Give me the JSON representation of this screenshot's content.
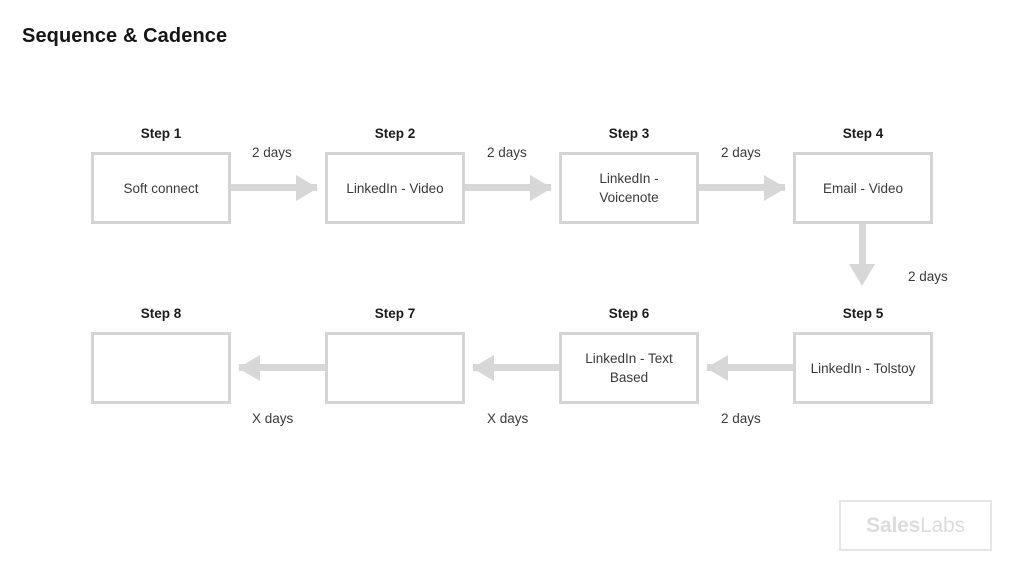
{
  "page": {
    "title": "Sequence & Cadence",
    "background_color": "#ffffff",
    "accent_color": "#d4d4d4",
    "text_color": "#3a3a3a"
  },
  "steps": [
    {
      "label": "Step 1",
      "content": "Soft connect"
    },
    {
      "label": "Step 2",
      "content": "LinkedIn - Video"
    },
    {
      "label": "Step 3",
      "content": "LinkedIn -\nVoicenote"
    },
    {
      "label": "Step 4",
      "content": "Email - Video"
    },
    {
      "label": "Step 5",
      "content": "LinkedIn - Tolstoy"
    },
    {
      "label": "Step 6",
      "content": "LinkedIn - Text\nBased"
    },
    {
      "label": "Step 7",
      "content": ""
    },
    {
      "label": "Step 8",
      "content": ""
    }
  ],
  "connectors": [
    {
      "from": "Step 1",
      "to": "Step 2",
      "delay": "2 days",
      "direction": "right"
    },
    {
      "from": "Step 2",
      "to": "Step 3",
      "delay": "2 days",
      "direction": "right"
    },
    {
      "from": "Step 3",
      "to": "Step 4",
      "delay": "2 days",
      "direction": "right"
    },
    {
      "from": "Step 4",
      "to": "Step 5",
      "delay": "2 days",
      "direction": "down"
    },
    {
      "from": "Step 5",
      "to": "Step 6",
      "delay": "2 days",
      "direction": "left"
    },
    {
      "from": "Step 6",
      "to": "Step 7",
      "delay": "X days",
      "direction": "left"
    },
    {
      "from": "Step 7",
      "to": "Step 8",
      "delay": "X days",
      "direction": "left"
    }
  ],
  "watermark": {
    "bold_part": "Sales",
    "regular_part": "Labs"
  }
}
